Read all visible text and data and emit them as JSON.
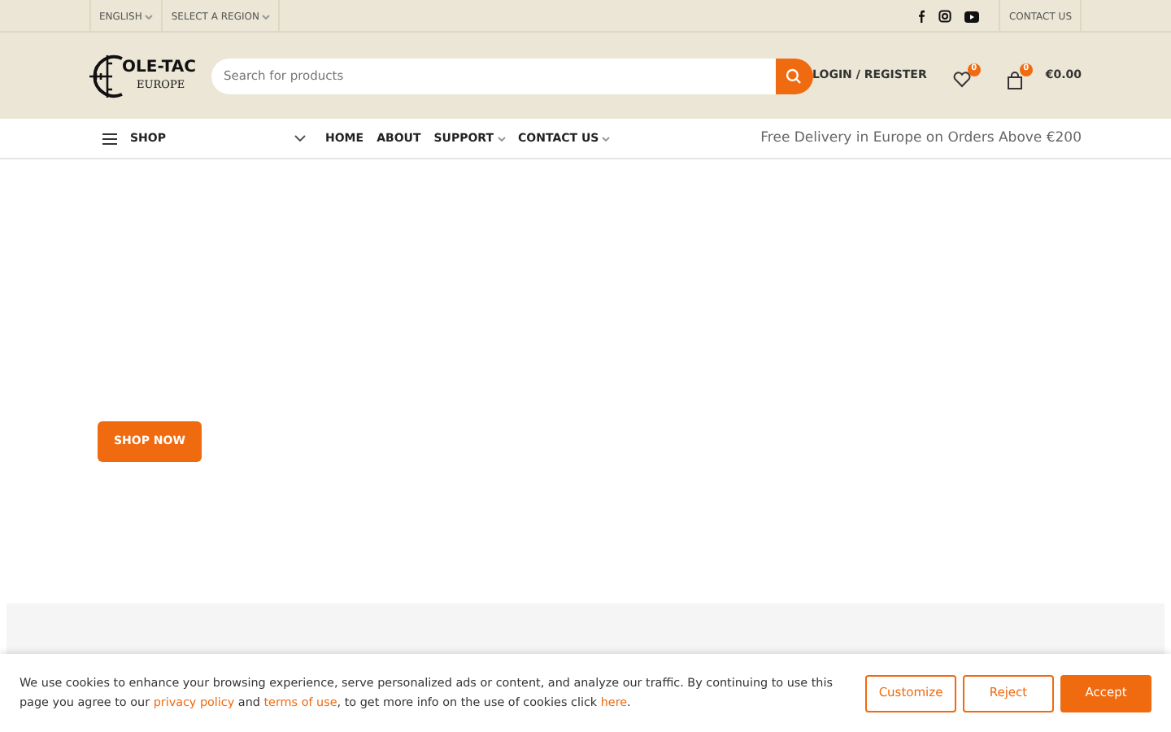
{
  "top_bar": {
    "language": "ENGLISH",
    "region": "SELECT A REGION",
    "contact": "CONTACT US"
  },
  "logo": {
    "name": "OLE-TAC",
    "sub": "EUROPE"
  },
  "search": {
    "placeholder": "Search for products"
  },
  "account": {
    "login": "LOGIN / REGISTER",
    "wishlist_count": "0",
    "cart_count": "0",
    "cart_total": "€0.00"
  },
  "nav": {
    "shop": "SHOP",
    "links": [
      {
        "label": "HOME",
        "has_menu": false
      },
      {
        "label": "ABOUT",
        "has_menu": false
      },
      {
        "label": "SUPPORT",
        "has_menu": true
      },
      {
        "label": "CONTACT US",
        "has_menu": true
      }
    ],
    "promo": "Free Delivery in Europe on Orders Above €200"
  },
  "hero": {
    "button": "SHOP NOW"
  },
  "cookie": {
    "text_before": "We use cookies to enhance your browsing experience, serve personalized ads or content, and analyze our traffic. By continuing to use this page you agree to our",
    "privacy": "privacy policy",
    "and": "and",
    "terms": "terms of use",
    "text_after": ", to get more info on the use of cookies click",
    "here": "here",
    "end": ".",
    "buttons": [
      {
        "label": "Customize",
        "kind": "outline"
      },
      {
        "label": "Reject",
        "kind": "outline"
      },
      {
        "label": "Accept",
        "kind": "solid"
      }
    ]
  }
}
